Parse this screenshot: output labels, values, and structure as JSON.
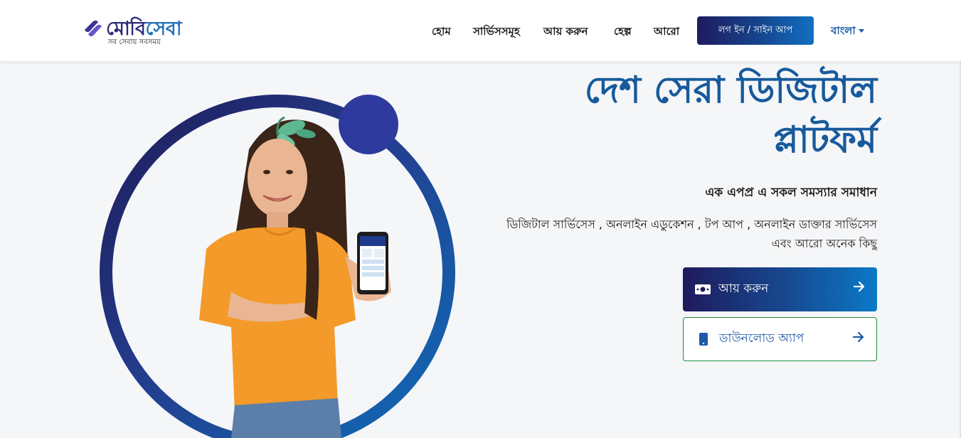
{
  "header": {
    "logo": {
      "name_part1": "মোবি",
      "name_part2": "সেবা",
      "tagline": "সব সেবায় সবসময়"
    },
    "nav": [
      {
        "label": "হোম"
      },
      {
        "label": "সার্ভিসসমূহ"
      },
      {
        "label": "আয় করুন"
      },
      {
        "label": "হেল্প"
      },
      {
        "label": "আরো"
      }
    ],
    "login_label": "লগ ইন / সাইন আপ",
    "language": "বাংলা"
  },
  "hero": {
    "title_line1": "দেশ সেরা ডিজিটাল",
    "title_line2": "প্লাটফর্ম",
    "subtitle": "এক এপপ্র এ সকল সমস্যার সমাধান",
    "description_line1": "ডিজিটাল সার্ভিসেস , অনলাইন এডুকেশন , টপ আপ , অনলাইন ডাক্তার সার্ভিসেস",
    "description_line2": "এবং আরো অনেক কিছু",
    "cta_earn": {
      "label": "আয় করুন",
      "icon": "money-icon"
    },
    "cta_download": {
      "label": "ডাউনলোড অ্যাপ",
      "icon": "mobile-phone-icon"
    }
  },
  "colors": {
    "brand_dark": "#1e1b5c",
    "brand_blue": "#175a9c",
    "brand_light_blue": "#0b79c7",
    "download_border": "#1f8a3a"
  }
}
